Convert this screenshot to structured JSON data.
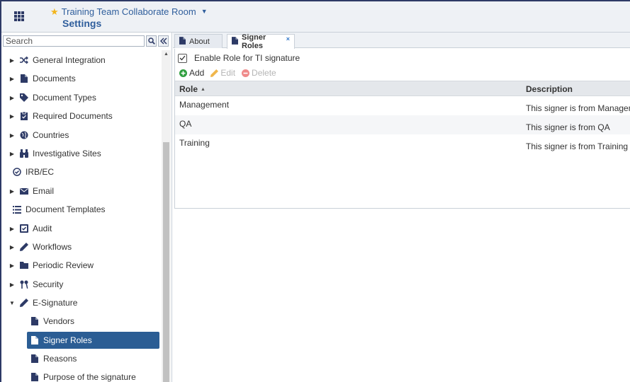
{
  "header": {
    "room_name": "Training Team Collaborate Room",
    "page_title": "Settings"
  },
  "sidebar": {
    "search_placeholder": "Search",
    "items": [
      {
        "label": "General Integration",
        "icon": "shuffle-icon",
        "expandable": true
      },
      {
        "label": "Documents",
        "icon": "document-icon",
        "expandable": true
      },
      {
        "label": "Document Types",
        "icon": "tag-icon",
        "expandable": true
      },
      {
        "label": "Required Documents",
        "icon": "clipboard-icon",
        "expandable": true
      },
      {
        "label": "Countries",
        "icon": "globe-icon",
        "expandable": true
      },
      {
        "label": "Investigative Sites",
        "icon": "binoculars-icon",
        "expandable": true
      },
      {
        "label": "IRB/EC",
        "icon": "check-circle-icon",
        "expandable": false
      },
      {
        "label": "Email",
        "icon": "envelope-icon",
        "expandable": true
      },
      {
        "label": "Document Templates",
        "icon": "list-icon",
        "expandable": false
      },
      {
        "label": "Audit",
        "icon": "audit-icon",
        "expandable": true
      },
      {
        "label": "Workflows",
        "icon": "pencil-icon",
        "expandable": true
      },
      {
        "label": "Periodic Review",
        "icon": "folder-icon",
        "expandable": true
      },
      {
        "label": "Security",
        "icon": "keys-icon",
        "expandable": true
      },
      {
        "label": "E-Signature",
        "icon": "pen-icon",
        "expandable": true,
        "expanded": true
      },
      {
        "label": "Vendors",
        "icon": "document-icon",
        "child": true
      },
      {
        "label": "Signer Roles",
        "icon": "document-icon",
        "child": true,
        "selected": true
      },
      {
        "label": "Reasons",
        "icon": "document-icon",
        "child": true
      },
      {
        "label": "Purpose of the signature",
        "icon": "document-icon",
        "child": true
      }
    ]
  },
  "tabs": [
    {
      "label": "About",
      "active": false
    },
    {
      "label": "Signer Roles",
      "active": true,
      "close": "×"
    }
  ],
  "panel": {
    "enable_label": "Enable Role for TI signature",
    "enable_checked": true,
    "toolbar": {
      "add_label": "Add",
      "edit_label": "Edit",
      "delete_label": "Delete"
    },
    "columns": {
      "role": "Role",
      "description": "Description"
    },
    "rows": [
      {
        "role": "Management",
        "description": "This signer is from Management"
      },
      {
        "role": "QA",
        "description": "This signer is from QA"
      },
      {
        "role": "Training",
        "description": "This signer is from Training"
      }
    ]
  },
  "colors": {
    "accent": "#2f5e9c",
    "selected_bg": "#2b5d94",
    "star": "#f2b51c",
    "add_green": "#2e9e3e",
    "edit_orange": "#f0b64c",
    "delete_red": "#ef8a8a"
  }
}
